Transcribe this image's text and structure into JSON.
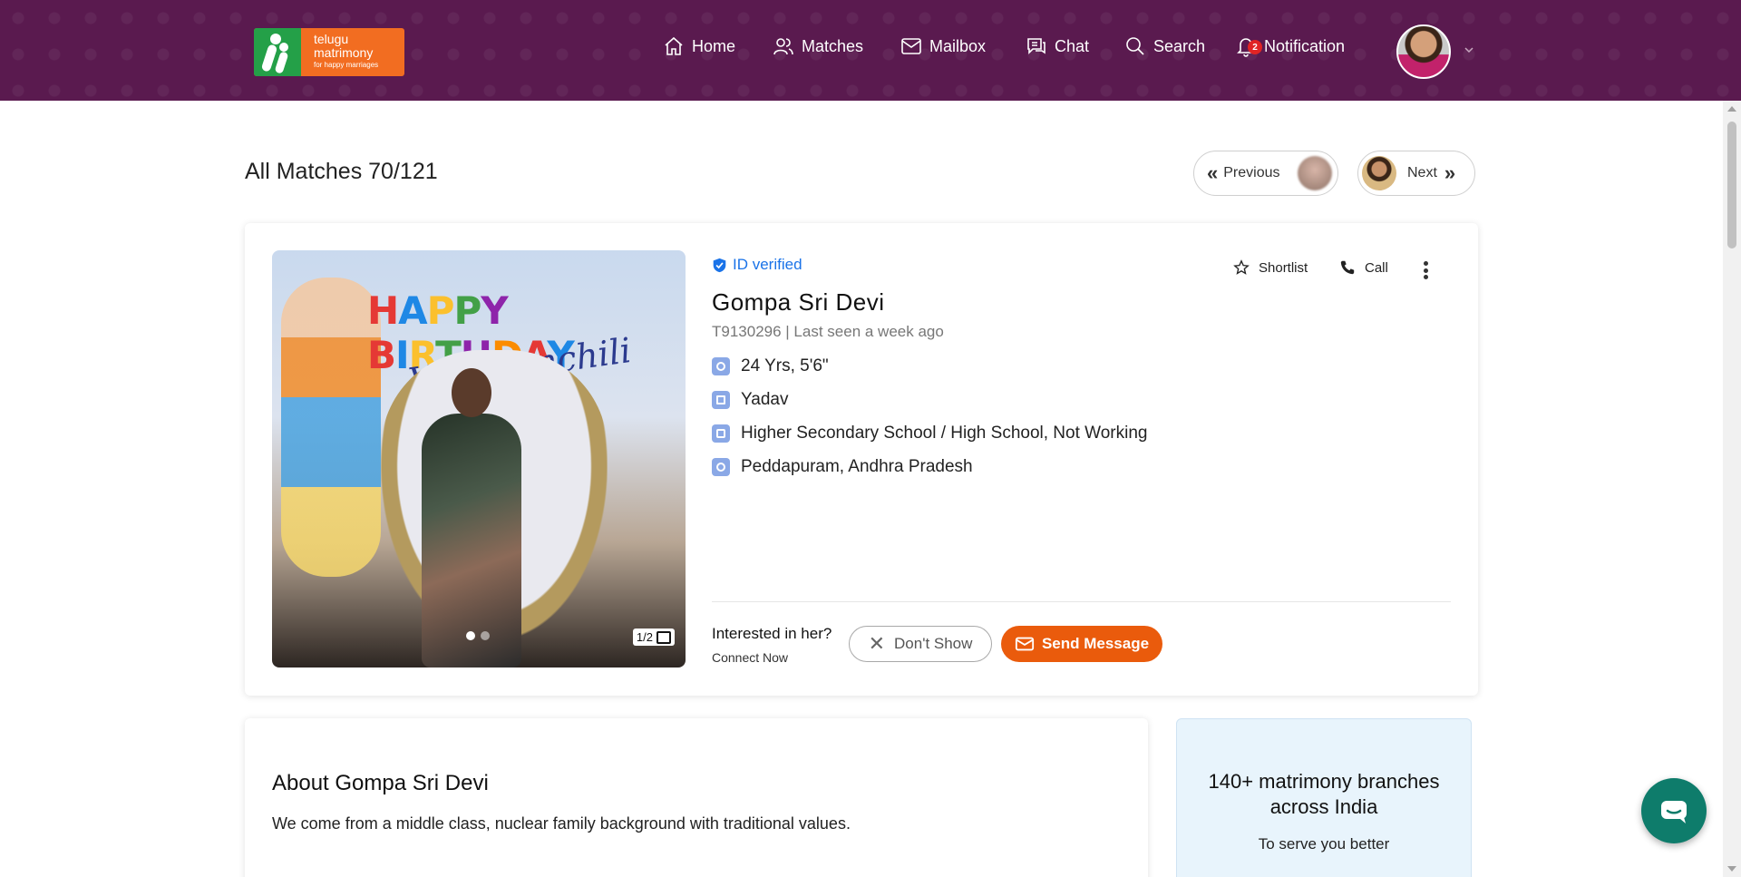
{
  "header": {
    "logo": {
      "line1": "telugu",
      "line2": "matrimony",
      "tagline": "for happy marriages"
    },
    "nav": [
      {
        "label": "Home",
        "icon": "home-icon"
      },
      {
        "label": "Matches",
        "icon": "users-icon"
      },
      {
        "label": "Mailbox",
        "icon": "mail-icon"
      },
      {
        "label": "Chat",
        "icon": "chat-icon"
      },
      {
        "label": "Search",
        "icon": "search-icon"
      },
      {
        "label": "Notification",
        "icon": "bell-icon",
        "badge": "2"
      }
    ],
    "colors": {
      "background": "#5a1a4f",
      "logo_orange": "#f26d21",
      "logo_green": "#24a048"
    }
  },
  "page": {
    "title": "All Matches 70/121",
    "previous_label": "Previous",
    "next_label": "Next"
  },
  "profile": {
    "verified_label": "ID verified",
    "name": "Gompa Sri Devi",
    "meta": "T9130296 | Last seen a week ago",
    "details": [
      {
        "icon": "age-icon",
        "text": "24 Yrs, 5'6\""
      },
      {
        "icon": "caste-icon",
        "text": "Yadav"
      },
      {
        "icon": "education-icon",
        "text": "Higher Secondary School / High School, Not Working"
      },
      {
        "icon": "location-icon",
        "text": "Peddapuram, Andhra Pradesh"
      }
    ],
    "photo": {
      "counter": "1/2",
      "banner": "HAPPY BIRTHDAY",
      "banner_script": "Valamanchili",
      "photo_count": 2,
      "active_index": 0
    },
    "actions": {
      "shortlist": "Shortlist",
      "call": "Call"
    },
    "interest": {
      "question": "Interested in her?",
      "sub": "Connect Now",
      "dont_show": "Don't Show",
      "send_message": "Send Message"
    },
    "colors": {
      "verified": "#1a73e8",
      "send_message": "#ea5b0c"
    }
  },
  "about": {
    "title": "About Gompa Sri Devi",
    "text": "We come from a middle class, nuclear family background with traditional values."
  },
  "branches": {
    "title": "140+ matrimony branches across India",
    "subtitle": "To serve you better"
  }
}
